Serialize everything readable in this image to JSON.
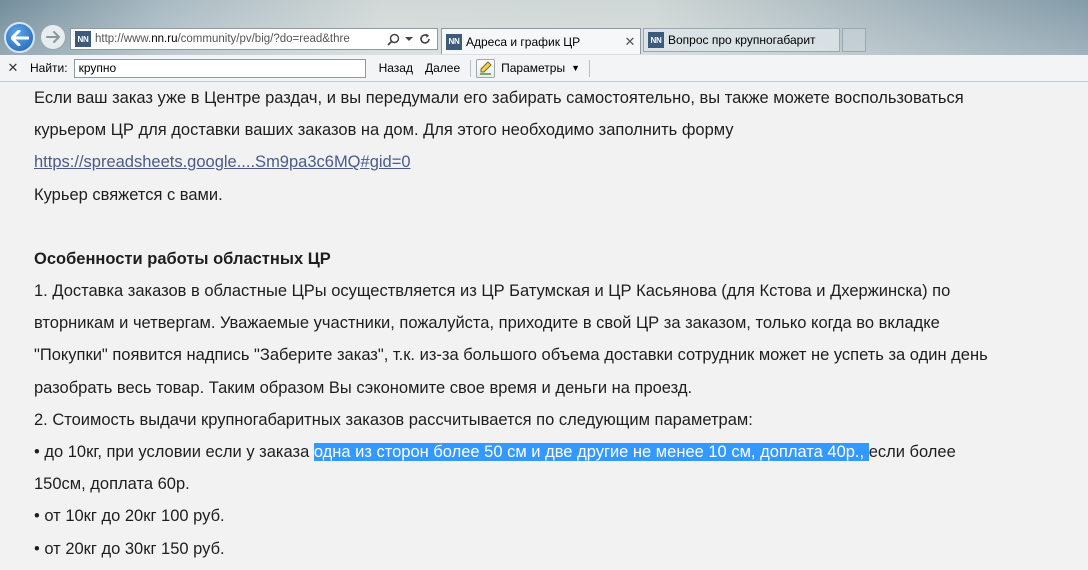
{
  "browser": {
    "address": {
      "url_prefix": "http://www.",
      "url_domain": "nn.ru",
      "url_rest": "/community/pv/big/?do=read&thre",
      "favicon_text": "NN"
    },
    "tabs": [
      {
        "label": "Адреса и график ЦР",
        "favicon_text": "NN",
        "active": true
      },
      {
        "label": "Вопрос про крупногабарит",
        "favicon_text": "NN",
        "active": false
      }
    ]
  },
  "findbar": {
    "label": "Найти:",
    "value": "крупно",
    "prev_label": "Назад",
    "next_label": "Далее",
    "options_label": "Параметры"
  },
  "content": {
    "para1_line1": "Если ваш заказ уже в Центре раздач, и вы передумали его забирать самостоятельно, вы также можете воспользоваться",
    "para1_line2": "курьером ЦР для доставки ваших заказов на дом. Для этого необходимо заполнить форму",
    "link": "https://spreadsheets.google....Sm9pa3c6MQ#gid=0",
    "courier": "Курьер свяжется с вами.",
    "heading": "Особенности работы областных ЦР",
    "item1_line1": "1. Доставка заказов в областные ЦРы осуществляется из ЦР Батумская и ЦР Касьянова (для Кстова и Дхержинска) по",
    "item1_line2": "вторникам и четвергам. Уважаемые участники, пожалуйста, приходите в свой ЦР за заказом, только когда во вкладке",
    "item1_line3": "\"Покупки\" появится надпись \"Заберите заказ\", т.к. из-за большого объема доставки сотрудник может не успеть за один день",
    "item1_line4": "разобрать весь товар. Таким образом Вы сэкономите свое время и деньги на проезд.",
    "item2": "2. Стоимость выдачи крупногабаритных заказов рассчитывается по следующим параметрам:",
    "bullet1_pre": "• до 10кг, при условии если у заказа ",
    "bullet1_highlight": "одна из сторон более 50 см и две другие не менее 10 см, доплата 40р., ",
    "bullet1_post": "если более",
    "bullet1_line2": "150см, доплата 60р.",
    "bullet2": "• от 10кг до 20кг 100 руб.",
    "bullet3": "• от 20кг до 30кг 150 руб."
  },
  "colors": {
    "selection": "#3399ff",
    "link": "#4a5b8c",
    "page_background": "#f2f2f2"
  }
}
